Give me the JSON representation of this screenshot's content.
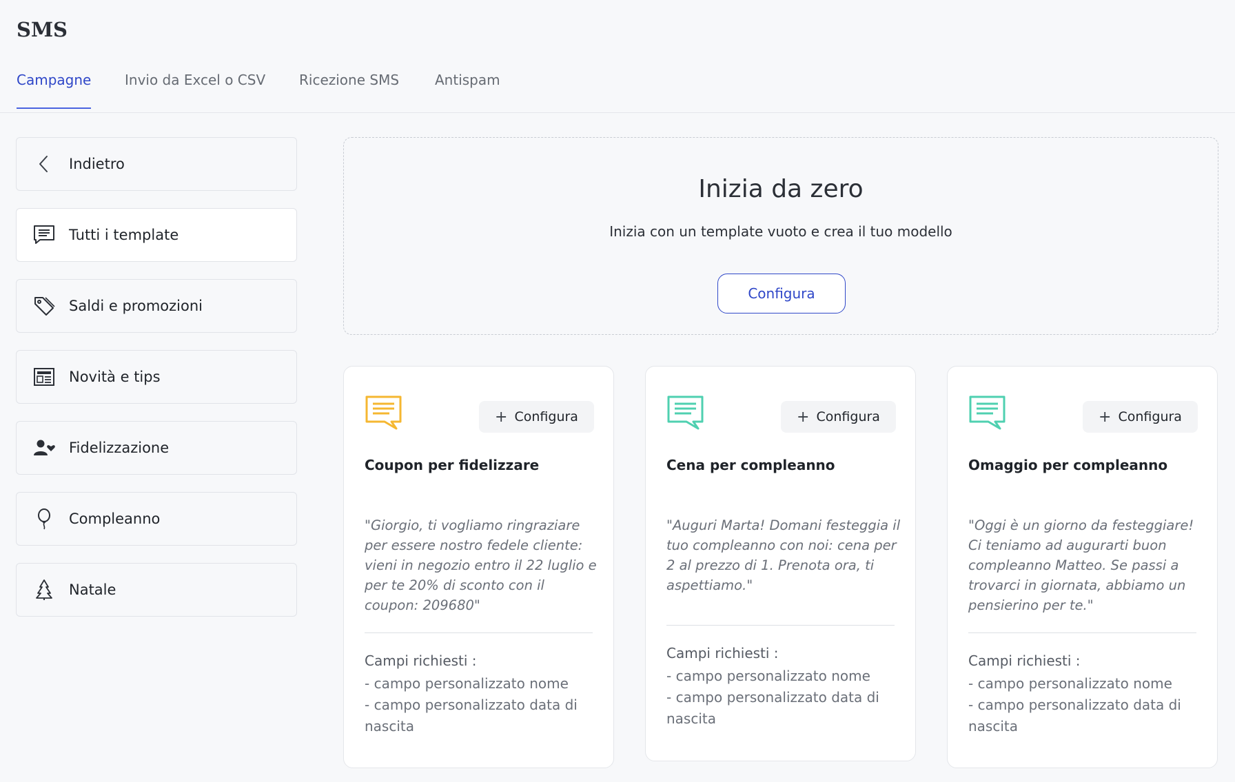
{
  "app": {
    "title": "SMS"
  },
  "tabs": [
    {
      "label": "Campagne",
      "active": true
    },
    {
      "label": "Invio da Excel o CSV",
      "active": false
    },
    {
      "label": "Ricezione SMS",
      "active": false
    },
    {
      "label": "Antispam",
      "active": false
    }
  ],
  "sidebar": {
    "items": [
      {
        "label": "Indietro",
        "icon": "chevron-left-icon"
      },
      {
        "label": "Tutti i template",
        "icon": "message-lines-icon",
        "selected": true
      },
      {
        "label": "Saldi e promozioni",
        "icon": "tags-icon"
      },
      {
        "label": "Novità e tips",
        "icon": "newspaper-icon"
      },
      {
        "label": "Fidelizzazione",
        "icon": "user-heart-icon"
      },
      {
        "label": "Compleanno",
        "icon": "balloon-icon"
      },
      {
        "label": "Natale",
        "icon": "tree-icon"
      }
    ]
  },
  "hero": {
    "title": "Inizia da zero",
    "subtitle": "Inizia con un template vuoto e crea il tuo modello",
    "button": "Configura"
  },
  "cards": [
    {
      "title": "Coupon per fidelizzare",
      "button": "Configura",
      "message": "\"Giorgio, ti vogliamo ringraziare per essere nostro fedele cliente: vieni in negozio entro il 22 luglio e per te 20% di sconto con il coupon: 209680\"",
      "required_title": "Campi richiesti :",
      "required": [
        "- campo personalizzato nome",
        "- campo personalizzato data di nascita"
      ],
      "icon_color": "#f5b731"
    },
    {
      "title": "Cena per compleanno",
      "button": "Configura",
      "message": "\"Auguri Marta! Domani festeggia il tuo compleanno con noi: cena per 2 al prezzo di 1. Prenota ora, ti aspettiamo.\"",
      "required_title": "Campi richiesti :",
      "required": [
        "- campo personalizzato nome",
        "- campo personalizzato data di nascita"
      ],
      "icon_color": "#4fd0b0"
    },
    {
      "title": "Omaggio per compleanno",
      "button": "Configura",
      "message": "\"Oggi è un giorno da festeggiare! Ci teniamo ad augurarti buon compleanno Matteo. Se passi a trovarci in giornata, abbiamo un pensierino per te.\"",
      "required_title": "Campi richiesti :",
      "required": [
        "- campo personalizzato nome",
        "- campo personalizzato data di nascita"
      ],
      "icon_color": "#4fd0b0"
    }
  ],
  "colors": {
    "accent": "#2f47c8",
    "background": "#f7f8fa"
  }
}
